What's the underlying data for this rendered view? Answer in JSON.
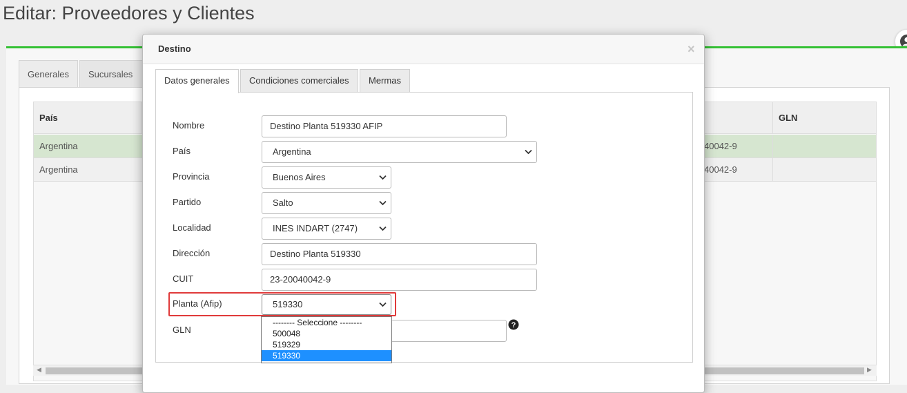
{
  "page": {
    "title": "Editar: Proveedores y Clientes"
  },
  "background": {
    "tabs": [
      "Generales",
      "Sucursales"
    ],
    "table": {
      "headers": {
        "pais": "País",
        "gln": "GLN"
      },
      "rows": [
        {
          "pais": "Argentina",
          "cuit": "40042-9",
          "gln": ""
        },
        {
          "pais": "Argentina",
          "cuit": "40042-9",
          "gln": ""
        }
      ]
    }
  },
  "modal": {
    "title": "Destino",
    "close_glyph": "×",
    "tabs": [
      "Datos generales",
      "Condiciones comerciales",
      "Mermas"
    ],
    "fields": {
      "nombre": {
        "label": "Nombre",
        "value": "Destino Planta 519330 AFIP"
      },
      "pais": {
        "label": "País",
        "value": "Argentina"
      },
      "provincia": {
        "label": "Provincia",
        "value": "Buenos Aires"
      },
      "partido": {
        "label": "Partido",
        "value": "Salto"
      },
      "localidad": {
        "label": "Localidad",
        "value": "INES INDART (2747)"
      },
      "direccion": {
        "label": "Dirección",
        "value": "Destino Planta 519330"
      },
      "cuit": {
        "label": "CUIT",
        "value": "23-20040042-9"
      },
      "planta": {
        "label": "Planta (Afip)",
        "value": "519330",
        "options": [
          "-------- Seleccione --------",
          "500048",
          "519329",
          "519330"
        ],
        "selected_index": 3
      },
      "gln": {
        "label": "GLN",
        "value": ""
      }
    },
    "highlight_color": "#e03a3a"
  },
  "icons": {
    "user": "user-circle-icon",
    "close": "close-icon",
    "chevron": "chevron-down-icon",
    "help": "help-icon"
  }
}
